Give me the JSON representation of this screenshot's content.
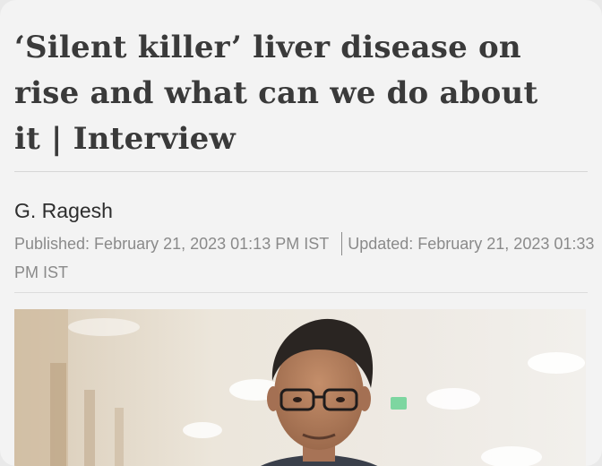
{
  "article": {
    "headline_line1": "‘Silent killer’ liver disease on",
    "headline_line2": "rise and what can we do about",
    "headline_line3": "it | Interview",
    "author": "G. Ragesh",
    "published": "Published: February 21, 2023 01:13 PM IST",
    "updated": "Updated: February 21, 2023 01:33 PM IST"
  },
  "image": {
    "icon": "person-photo",
    "background_color": "#e8e2d6",
    "accent_sign_color": "#7dd6a0"
  }
}
